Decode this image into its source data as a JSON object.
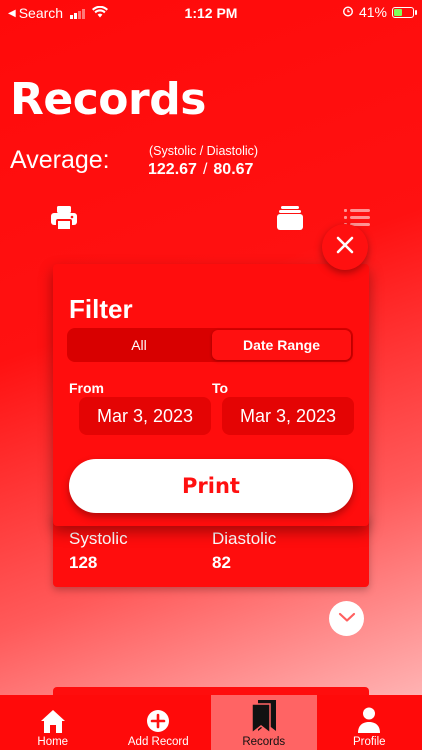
{
  "status_bar": {
    "back_label": "Search",
    "time": "1:12 PM",
    "battery": "41%"
  },
  "header": {
    "title": "Records",
    "average_label": "Average:",
    "average_sub": "(Systolic / Diastolic)",
    "systolic_avg": "122.67",
    "separator": "/",
    "diastolic_avg": "80.67"
  },
  "toolbar_icons": [
    "printer-icon",
    "cards-stack-icon",
    "list-icon"
  ],
  "filter": {
    "title": "Filter",
    "segments": [
      {
        "label": "All",
        "selected": false
      },
      {
        "label": "Date Range",
        "selected": true
      }
    ],
    "from_label": "From",
    "to_label": "To",
    "from_date": "Mar 3, 2023",
    "to_date": "Mar 3, 2023",
    "print_label": "Print"
  },
  "record": {
    "systolic_label": "Systolic",
    "systolic_value": "128",
    "diastolic_label": "Diastolic",
    "diastolic_value": "82"
  },
  "tabs": [
    {
      "label": "Home",
      "icon": "home-icon",
      "active": false
    },
    {
      "label": "Add Record",
      "icon": "add-circle-icon",
      "active": false
    },
    {
      "label": "Records",
      "icon": "bookmarks-icon",
      "active": true
    },
    {
      "label": "Profile",
      "icon": "person-icon",
      "active": false
    }
  ],
  "colors": {
    "accent": "#ff0d0d",
    "active_tab": "#ff6464"
  }
}
